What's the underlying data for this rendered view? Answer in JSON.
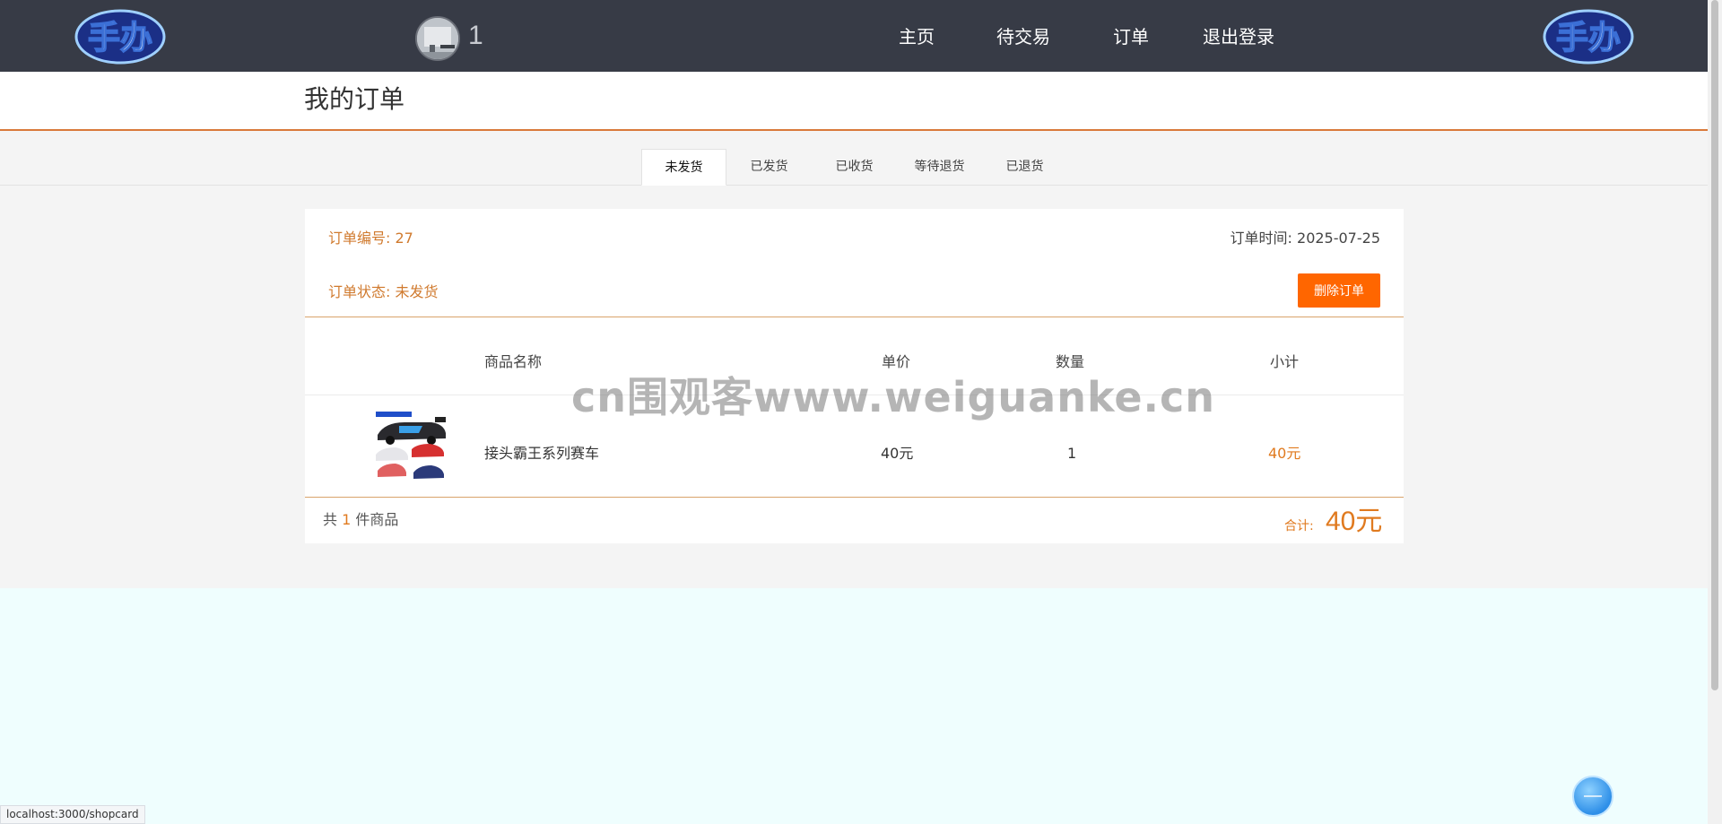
{
  "header": {
    "user_number": "1",
    "nav": [
      "主页",
      "待交易",
      "订单",
      "退出登录"
    ],
    "logo_text": "手办",
    "accent_color": "#373b46"
  },
  "page": {
    "title": "我的订单"
  },
  "tabs": [
    {
      "label": "未发货",
      "active": true
    },
    {
      "label": "已发货",
      "active": false
    },
    {
      "label": "已收货",
      "active": false
    },
    {
      "label": "等待退货",
      "active": false
    },
    {
      "label": "已退货",
      "active": false
    }
  ],
  "order": {
    "number_text": "订单编号: 27",
    "time_text": "订单时间: 2025-07-25",
    "status_text": "订单状态: 未发货",
    "delete_label": "删除订单",
    "columns": [
      "商品名称",
      "单价",
      "数量",
      "小计"
    ],
    "items": [
      {
        "name": "接头霸王系列赛车",
        "price": "40元",
        "qty": "1",
        "subtotal": "40元"
      }
    ],
    "footer": {
      "count_prefix": "共",
      "count": "1",
      "count_suffix": "件商品",
      "total_label": "合计:",
      "total_value": "40元"
    },
    "accent_color": "#ff6600"
  },
  "watermark": "cn围观客www.weiguanke.cn",
  "status_bar_url": "localhost:3000/shopcard"
}
